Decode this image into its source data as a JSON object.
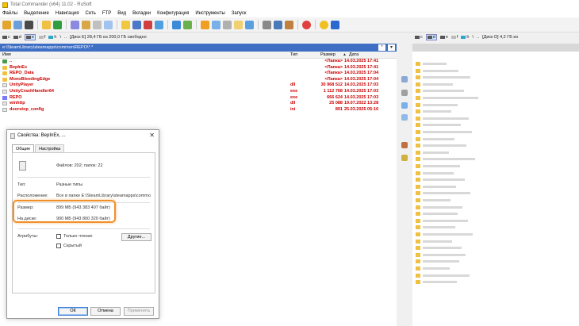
{
  "window": {
    "title": "Total Commander (x64) 11.02 - RuSoft"
  },
  "menu": [
    "Файлы",
    "Выделение",
    "Навигация",
    "Сеть",
    "FTP",
    "Вид",
    "Вкладки",
    "Конфигурация",
    "Инструменты",
    "Запуск"
  ],
  "left_drives": {
    "drives": [
      "c",
      "d",
      "e",
      "f",
      "h"
    ],
    "active": "e",
    "sep1": "\\",
    "sep2": "..",
    "info": "[Диск E]  28,4 ГБ из 200,0 ГБ свободно"
  },
  "right_drives": {
    "drives": [
      "c",
      "d",
      "e",
      "f",
      "h"
    ],
    "sep1": "\\",
    "sep2": "..",
    "info": "[Диск D]  4,2 ГБ из"
  },
  "left_path": "e:\\SteamLibrary\\steamapps\\common\\REPO\\*.*",
  "left_path_buttons": [
    "*",
    "▾"
  ],
  "columns": {
    "name": "Имя",
    "type": "Тип",
    "size": "Размер",
    "date": "Дата",
    "sort_indicator": "▲"
  },
  "files": [
    {
      "name": "..",
      "ext": "",
      "size": "<Папка>",
      "date": "14.03.2025 17:41",
      "icon": "up"
    },
    {
      "name": "BepInEx",
      "ext": "",
      "size": "<Папка>",
      "date": "14.03.2025 17:41",
      "icon": "folder"
    },
    {
      "name": "REPO_Data",
      "ext": "",
      "size": "<Папка>",
      "date": "14.03.2025 17:04",
      "icon": "folder"
    },
    {
      "name": "MonoBleedingEdge",
      "ext": "",
      "size": "<Папка>",
      "date": "14.03.2025 17:04",
      "icon": "folder"
    },
    {
      "name": "UnityPlayer",
      "ext": "dll",
      "size": "30 968 512",
      "date": "14.03.2025 17:03",
      "icon": "file"
    },
    {
      "name": "UnityCrashHandler64",
      "ext": "exe",
      "size": "1 112 768",
      "date": "14.03.2025 17:03",
      "icon": "file"
    },
    {
      "name": "REPO",
      "ext": "exe",
      "size": "666 624",
      "date": "14.03.2025 17:03",
      "icon": "exe"
    },
    {
      "name": "winhttp",
      "ext": "dll",
      "size": "25 088",
      "date": "19.07.2022 13:28",
      "icon": "file"
    },
    {
      "name": "doorstop_config",
      "ext": "ini",
      "size": "891",
      "date": "25.03.2025 05:16",
      "icon": "file"
    }
  ],
  "dialog": {
    "title": "Свойства: BepInEx, ...",
    "close": "✕",
    "tabs": [
      "Общие",
      "Настройка"
    ],
    "files_count": "Файлов: 202; папок: 22",
    "type_label": "Тип:",
    "type_value": "Разные типы",
    "location_label": "Расположение:",
    "location_value": "Все в папке E:\\SteamLibrary\\steamapps\\commo",
    "size_label": "Размер:",
    "size_value": "899 МБ (943 383 407 байт)",
    "disk_label": "На диске:",
    "disk_value": "900 МБ (943 800 320 байт)",
    "attrs_label": "Атрибуты:",
    "readonly_label": "Только чтение",
    "hidden_label": "Скрытый",
    "other_button": "Другие...",
    "ok_button": "ОК",
    "cancel_button": "Отмена",
    "apply_button": "Применить"
  },
  "colors": {
    "accent": "#3e6fc4",
    "highlight": "#f0902a",
    "file_text": "#cc0000",
    "folder": "#f0c040"
  }
}
